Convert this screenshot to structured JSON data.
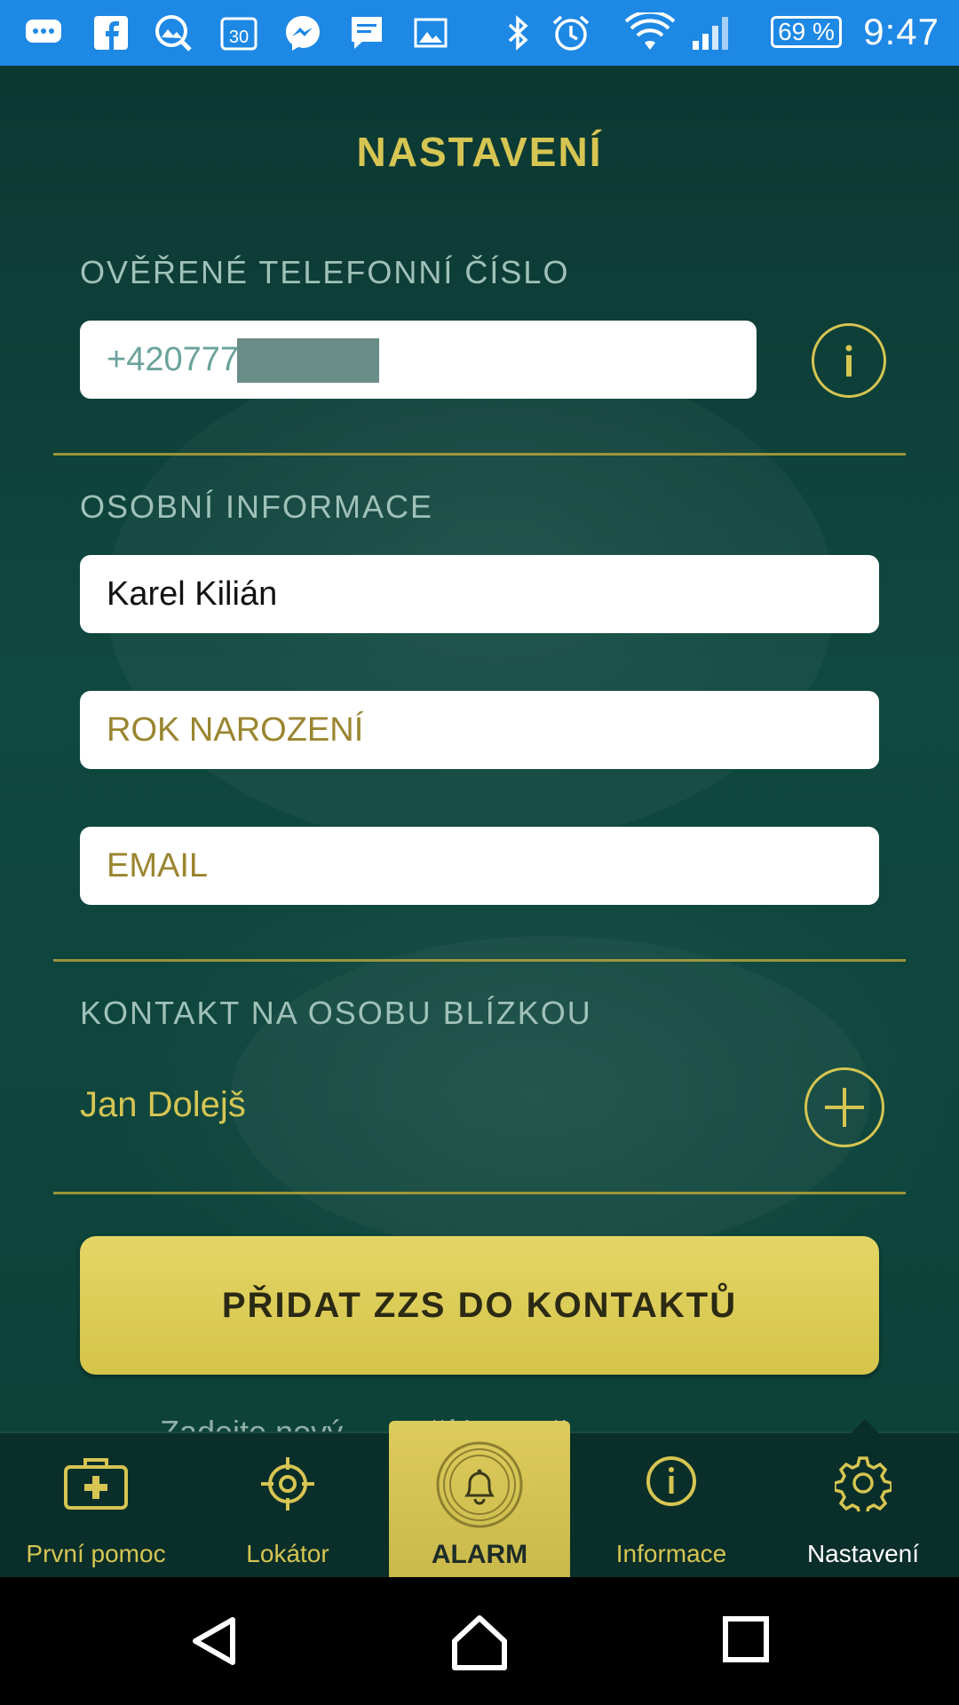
{
  "status_bar": {
    "time": "9:47",
    "battery": "69 %",
    "icons": [
      "chat-bubble-icon",
      "facebook-icon",
      "photo-search-icon",
      "calendar-30-icon",
      "messenger-icon",
      "message-icon",
      "image-icon",
      "bluetooth-icon",
      "alarm-clock-icon",
      "wifi-icon",
      "signal-icon"
    ]
  },
  "screen": {
    "title": "NASTAVENÍ",
    "phone_section": {
      "label": "OVĚŘENÉ TELEFONNÍ ČÍSLO",
      "value": "+420777"
    },
    "personal_section": {
      "label": "OSOBNÍ INFORMACE",
      "name_value": "Karel Kilián",
      "birth_year_placeholder": "ROK NAROZENÍ",
      "email_placeholder": "EMAIL"
    },
    "contact_section": {
      "label": "KONTAKT NA OSOBU BLÍZKOU",
      "contact_name": "Jan Dolejš"
    },
    "add_button": "PŘIDAT ZZS DO KONTAKTŮ",
    "peek_text": "Zadejte nový ... stačí jen Vaš"
  },
  "tabs": [
    {
      "label": "První pomoc",
      "icon": "first-aid-kit-icon"
    },
    {
      "label": "Lokátor",
      "icon": "crosshair-icon"
    },
    {
      "label": "ALARM",
      "icon": "bell-icon"
    },
    {
      "label": "Informace",
      "icon": "info-icon"
    },
    {
      "label": "Nastavení",
      "icon": "gear-icon",
      "active": true
    }
  ],
  "colors": {
    "accent": "#d6c552",
    "background": "#0d3b35",
    "status_bar": "#1e88e5",
    "button": "#d9c957"
  }
}
